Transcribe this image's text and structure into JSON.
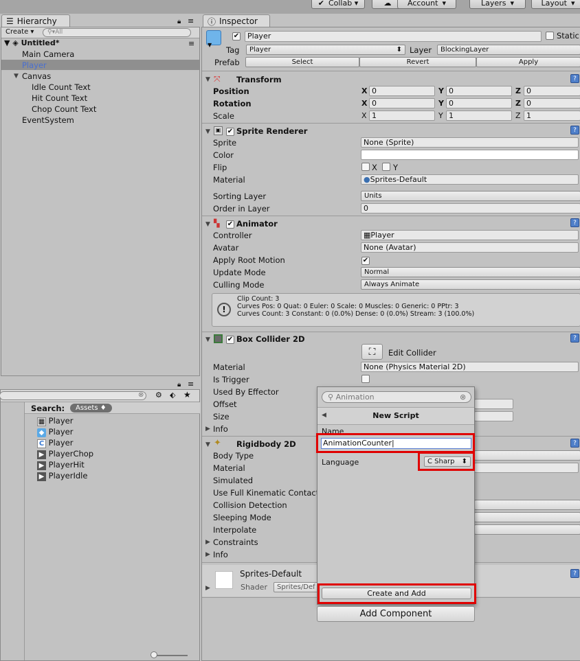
{
  "toolbar": {
    "collab": "Collab ▾",
    "account": "Account",
    "layers": "Layers",
    "layout": "Layout"
  },
  "hierarchy": {
    "tab": "Hierarchy",
    "create": "Create",
    "search_placeholder": "All",
    "scene": "Untitled*",
    "items": [
      "Main Camera",
      "Player",
      "Canvas",
      "Idle Count Text",
      "Hit Count Text",
      "Chop Count Text",
      "EventSystem"
    ]
  },
  "project": {
    "search_label": "Search:",
    "assets_badge": "Assets",
    "assets": [
      "Player",
      "Player",
      "Player",
      "PlayerChop",
      "PlayerHit",
      "PlayerIdle"
    ]
  },
  "inspector": {
    "tab": "Inspector",
    "object_name": "Player",
    "static_label": "Static",
    "tag_label": "Tag",
    "tag_value": "Player",
    "layer_label": "Layer",
    "layer_value": "BlockingLayer",
    "prefab_label": "Prefab",
    "prefab_select": "Select",
    "prefab_revert": "Revert",
    "prefab_apply": "Apply",
    "transform": {
      "title": "Transform",
      "position_label": "Position",
      "rotation_label": "Rotation",
      "scale_label": "Scale",
      "x": "X",
      "y": "Y",
      "z": "Z",
      "position": [
        "0",
        "0",
        "0"
      ],
      "rotation": [
        "0",
        "0",
        "0"
      ],
      "scale": [
        "1",
        "1",
        "1"
      ]
    },
    "sprite_renderer": {
      "title": "Sprite Renderer",
      "sprite_label": "Sprite",
      "sprite_value": "None (Sprite)",
      "color_label": "Color",
      "flip_label": "Flip",
      "flip_x": "X",
      "flip_y": "Y",
      "material_label": "Material",
      "material_value": "Sprites-Default",
      "sorting_label": "Sorting Layer",
      "sorting_value": "Units",
      "order_label": "Order in Layer",
      "order_value": "0"
    },
    "animator": {
      "title": "Animator",
      "controller_label": "Controller",
      "controller_value": "Player",
      "avatar_label": "Avatar",
      "avatar_value": "None (Avatar)",
      "root_motion_label": "Apply Root Motion",
      "update_label": "Update Mode",
      "update_value": "Normal",
      "culling_label": "Culling Mode",
      "culling_value": "Always Animate",
      "info_line1": "Clip Count: 3",
      "info_line2": "Curves Pos: 0 Quat: 0 Euler: 0 Scale: 0 Muscles: 0 Generic: 0 PPtr: 3",
      "info_line3": "Curves Count: 3 Constant: 0 (0.0%) Dense: 0 (0.0%) Stream: 3 (100.0%)"
    },
    "box_collider": {
      "title": "Box Collider 2D",
      "edit_collider": "Edit Collider",
      "material_label": "Material",
      "material_value": "None (Physics Material 2D)",
      "trigger_label": "Is Trigger",
      "effector_label": "Used By Effector",
      "offset_label": "Offset",
      "size_label": "Size",
      "info_label": "Info"
    },
    "rigidbody": {
      "title": "Rigidbody 2D",
      "body_type_label": "Body Type",
      "material_label": "Material",
      "simulated_label": "Simulated",
      "kinematic_label": "Use Full Kinematic Contact",
      "collision_label": "Collision Detection",
      "sleeping_label": "Sleeping Mode",
      "interpolate_label": "Interpolate",
      "constraints_label": "Constraints",
      "info_label": "Info"
    },
    "material_preview": {
      "name": "Sprites-Default",
      "shader_label": "Shader",
      "shader_value": "Sprites/Def"
    },
    "add_component": "Add Component"
  },
  "popup": {
    "search_value": "Animation",
    "header": "New Script",
    "name_label": "Name",
    "name_value": "AnimationCounter",
    "language_label": "Language",
    "language_value": "C Sharp",
    "create_button": "Create and Add"
  }
}
